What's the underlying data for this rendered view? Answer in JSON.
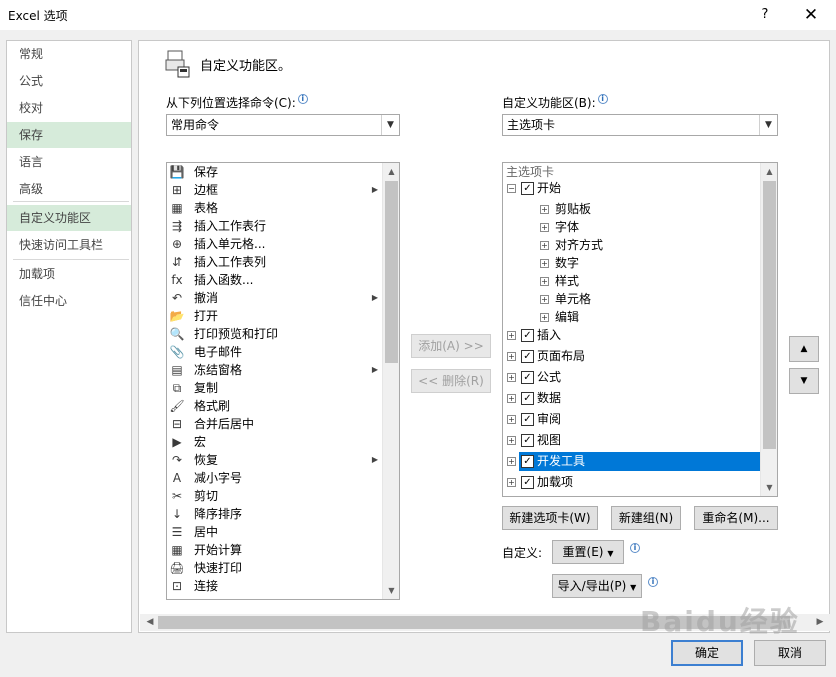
{
  "window": {
    "title": "Excel 选项",
    "help_label": "?",
    "close_label": "✕"
  },
  "nav": {
    "items": [
      {
        "label": "常规"
      },
      {
        "label": "公式"
      },
      {
        "label": "校对"
      },
      {
        "label": "保存"
      },
      {
        "label": "语言"
      },
      {
        "label": "高级"
      },
      {
        "label": "自定义功能区"
      },
      {
        "label": "快速访问工具栏"
      },
      {
        "label": "加载项"
      },
      {
        "label": "信任中心"
      }
    ]
  },
  "main": {
    "heading": "自定义功能区。",
    "commands_label": "从下列位置选择命令(C):",
    "commands_value": "常用命令",
    "ribbon_label": "自定义功能区(B):",
    "ribbon_value": "主选项卡",
    "commands": [
      {
        "label": "保存",
        "icon": "💾"
      },
      {
        "label": "边框",
        "icon": "⊞",
        "submenu": "▶"
      },
      {
        "label": "表格",
        "icon": "▦"
      },
      {
        "label": "插入工作表行",
        "icon": "⇶"
      },
      {
        "label": "插入单元格...",
        "icon": "⊕"
      },
      {
        "label": "插入工作表列",
        "icon": "⇵"
      },
      {
        "label": "插入函数...",
        "icon": "fx"
      },
      {
        "label": "撤消",
        "icon": "↶",
        "submenu": "▶"
      },
      {
        "label": "打开",
        "icon": "📂"
      },
      {
        "label": "打印预览和打印",
        "icon": "🔍"
      },
      {
        "label": "电子邮件",
        "icon": "📎"
      },
      {
        "label": "冻结窗格",
        "icon": "▤",
        "submenu": "▶"
      },
      {
        "label": "复制",
        "icon": "⧉"
      },
      {
        "label": "格式刷",
        "icon": "🖌"
      },
      {
        "label": "合并后居中",
        "icon": "⊟"
      },
      {
        "label": "宏",
        "icon": "▶"
      },
      {
        "label": "恢复",
        "icon": "↷",
        "submenu": "▶"
      },
      {
        "label": "减小字号",
        "icon": "A"
      },
      {
        "label": "剪切",
        "icon": "✂"
      },
      {
        "label": "降序排序",
        "icon": "↓"
      },
      {
        "label": "居中",
        "icon": "☰"
      },
      {
        "label": "开始计算",
        "icon": "▦"
      },
      {
        "label": "快速打印",
        "icon": "🖨"
      },
      {
        "label": "连接",
        "icon": "⊡"
      }
    ],
    "add_button": "添加(A) >>",
    "remove_button": "<< 删除(R)",
    "tree_header": "主选项卡",
    "tree": [
      {
        "label": "开始",
        "level": 0,
        "expanded": true,
        "checked": true
      },
      {
        "label": "剪贴板",
        "level": 1
      },
      {
        "label": "字体",
        "level": 1
      },
      {
        "label": "对齐方式",
        "level": 1
      },
      {
        "label": "数字",
        "level": 1
      },
      {
        "label": "样式",
        "level": 1
      },
      {
        "label": "单元格",
        "level": 1
      },
      {
        "label": "编辑",
        "level": 1
      },
      {
        "label": "插入",
        "level": 0,
        "checked": true
      },
      {
        "label": "页面布局",
        "level": 0,
        "checked": true
      },
      {
        "label": "公式",
        "level": 0,
        "checked": true
      },
      {
        "label": "数据",
        "level": 0,
        "checked": true
      },
      {
        "label": "审阅",
        "level": 0,
        "checked": true
      },
      {
        "label": "视图",
        "level": 0,
        "checked": true
      },
      {
        "label": "开发工具",
        "level": 0,
        "checked": true,
        "selected": true
      },
      {
        "label": "加载项",
        "level": 0,
        "checked": true
      }
    ],
    "new_tab_button": "新建选项卡(W)",
    "new_group_button": "新建组(N)",
    "rename_button": "重命名(M)...",
    "customize_label": "自定义:",
    "reset_button": "重置(E)",
    "import_export_button": "导入/导出(P)",
    "move_up": "▲",
    "move_down": "▼"
  },
  "footer": {
    "ok_button": "确定",
    "cancel_button": "取消"
  },
  "watermark": "Baidu经验",
  "colors": {
    "selected_nav": "#d6ebda",
    "selected_tree": "#0078d7",
    "accent": "#3c7fd1"
  }
}
